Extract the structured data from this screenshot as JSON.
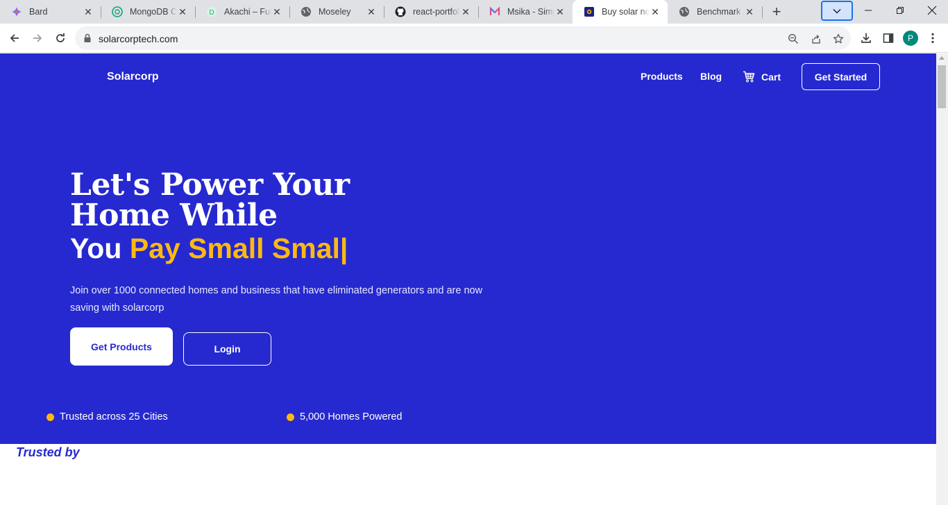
{
  "browser": {
    "tabs": [
      {
        "title": "Bard",
        "icon": "bard-sparkle-icon"
      },
      {
        "title": "MongoDB Co",
        "icon": "chatgpt-icon"
      },
      {
        "title": "Akachi – Full",
        "icon": "akachi-icon"
      },
      {
        "title": "Moseley",
        "icon": "globe-icon"
      },
      {
        "title": "react-portfol",
        "icon": "github-icon"
      },
      {
        "title": "Msika - Simp",
        "icon": "msika-icon"
      },
      {
        "title": "Buy solar no",
        "icon": "solarcorp-icon",
        "active": true
      },
      {
        "title": "Benchmark A",
        "icon": "globe-icon"
      }
    ],
    "new_tab_label": "+",
    "address": "solarcorptech.com",
    "profile_initial": "P"
  },
  "site": {
    "brand": "Solarcorp",
    "nav": {
      "products": "Products",
      "blog": "Blog",
      "cart": "Cart",
      "get_started": "Get Started"
    },
    "hero": {
      "headline": "Let's Power Your Home While",
      "subline_prefix": "You",
      "subline_highlight": "Pay Small Smal|",
      "description": "Join over 1000 connected homes and business that have eliminated generators and are now saving with solarcorp",
      "cta_primary": "Get Products",
      "cta_secondary": "Login"
    },
    "stats": [
      "Trusted across 25 Cities",
      "5,000 Homes Powered"
    ],
    "trusted_by": "Trusted by"
  },
  "colors": {
    "hero_bg": "#2629cf",
    "accent": "#fdb913",
    "text_on_hero": "#ffffff"
  }
}
